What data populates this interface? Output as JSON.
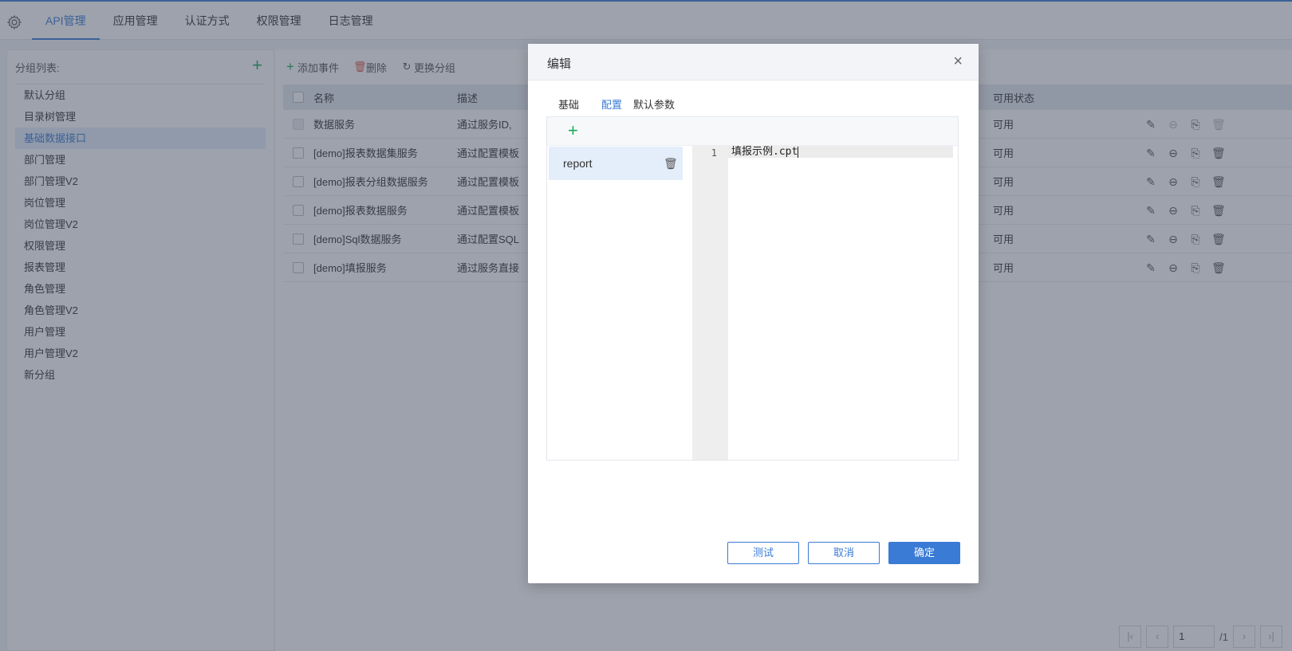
{
  "nav": {
    "tabs": [
      {
        "label": "API管理"
      },
      {
        "label": "应用管理"
      },
      {
        "label": "认证方式"
      },
      {
        "label": "权限管理"
      },
      {
        "label": "日志管理"
      }
    ]
  },
  "sidebar": {
    "header": "分组列表:",
    "add_icon": "+",
    "groups": [
      "默认分组",
      "目录树管理",
      "基础数据接口",
      "部门管理",
      "部门管理V2",
      "岗位管理",
      "岗位管理V2",
      "权限管理",
      "报表管理",
      "角色管理",
      "角色管理V2",
      "用户管理",
      "用户管理V2",
      "新分组"
    ],
    "selected": "基础数据接口"
  },
  "toolbar": {
    "add_label": "添加事件",
    "delete_label": "删除",
    "change_group_label": "更换分组"
  },
  "table": {
    "headers": {
      "name": "名称",
      "desc": "描述",
      "status": "可用状态"
    },
    "rows": [
      {
        "name": "数据服务",
        "desc": "通过服务ID,",
        "status": "可用"
      },
      {
        "name": "[demo]报表数据集服务",
        "desc": "通过配置模板",
        "status": "可用"
      },
      {
        "name": "[demo]报表分组数据服务",
        "desc": "通过配置模板",
        "status": "可用"
      },
      {
        "name": "[demo]报表数据服务",
        "desc": "通过配置模板",
        "status": "可用"
      },
      {
        "name": "[demo]Sql数据服务",
        "desc": "通过配置SQL",
        "status": "可用"
      },
      {
        "name": "[demo]填报服务",
        "desc": "通过服务直接",
        "status": "可用"
      }
    ]
  },
  "pager": {
    "current": "1",
    "total": "/1"
  },
  "dialog": {
    "title": "编辑",
    "close_icon": "×",
    "tabs": [
      "基础",
      "配置",
      "默认参数"
    ],
    "active_tab": "配置",
    "config_item": "report",
    "editor": {
      "line_number": "1",
      "code": "填报示例.cpt"
    },
    "buttons": {
      "test": "测试",
      "cancel": "取消",
      "ok": "确定"
    }
  },
  "colors": {
    "accent": "#3a7bd5",
    "add_green": "#1aad5b",
    "delete_red": "#e05a4e"
  }
}
